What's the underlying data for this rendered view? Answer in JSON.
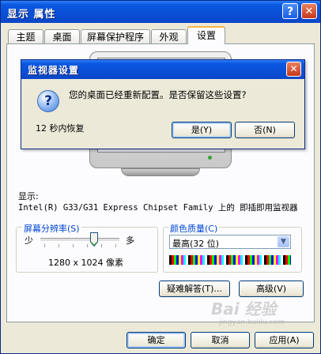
{
  "window": {
    "title": "显示 属性",
    "help_glyph": "?",
    "close_glyph": "✕"
  },
  "tabs": [
    {
      "label": "主题"
    },
    {
      "label": "桌面"
    },
    {
      "label": "屏幕保护程序"
    },
    {
      "label": "外观"
    },
    {
      "label": "设置",
      "active": true
    }
  ],
  "settings": {
    "display_label": "显示:",
    "monitor_desc": "Intel(R) G33/G31 Express Chipset Family 上的 即插即用监视器",
    "resolution": {
      "title": "屏幕分辨率(S)",
      "less": "少",
      "more": "多",
      "value": "1280 x 1024 像素",
      "slider_level": 0.75
    },
    "color_quality": {
      "title": "颜色质量(C)",
      "selected": "最高(32 位)",
      "arrow_glyph": "▼"
    },
    "troubleshoot_button": "疑难解答(T)...",
    "advanced_button": "高级(V)"
  },
  "footer": {
    "ok": "确定",
    "cancel": "取消",
    "apply": "应用(A)"
  },
  "dialog": {
    "title": "监视器设置",
    "close_glyph": "✕",
    "icon_glyph": "?",
    "message": "您的桌面已经重新配置。是否保留这些设置?",
    "countdown": "12 秒内恢复",
    "yes": "是(Y)",
    "no": "否(N)"
  },
  "watermark": {
    "text": "Bai 经验",
    "url": "jingyan.baidu.com"
  }
}
